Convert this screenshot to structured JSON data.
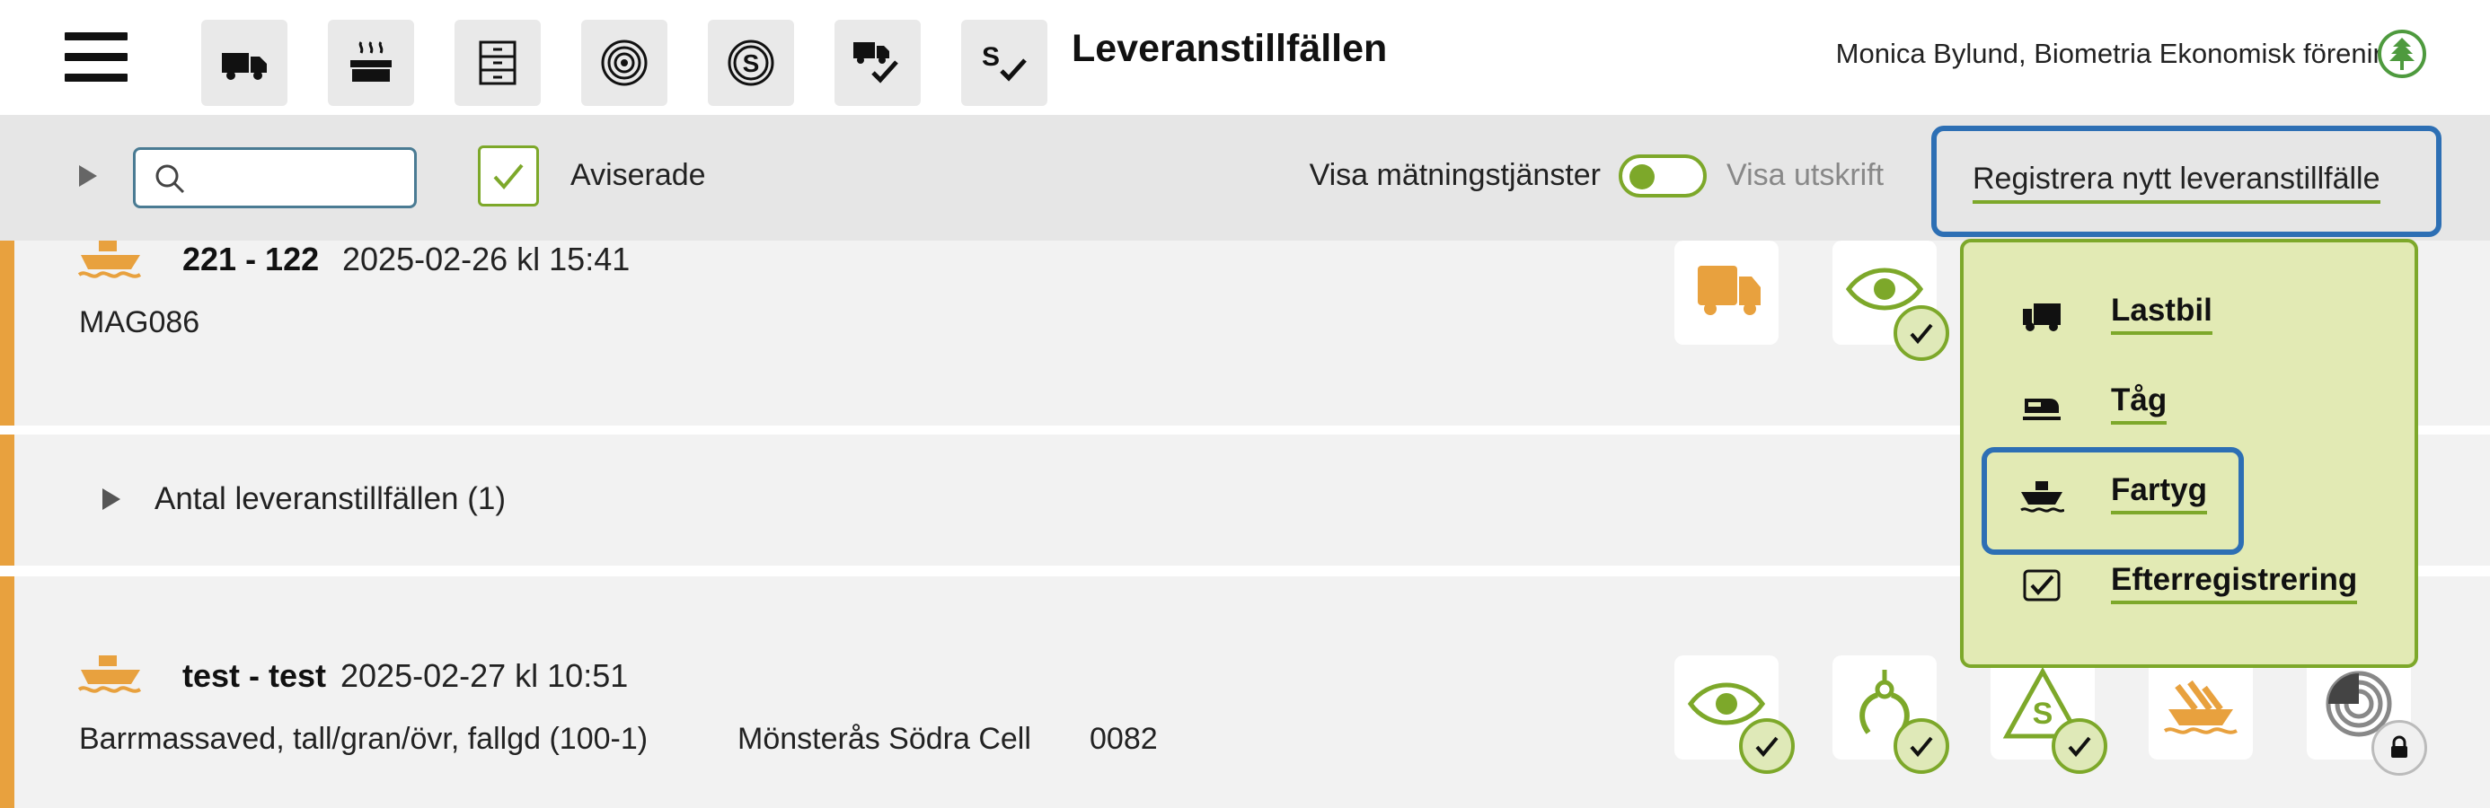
{
  "header": {
    "title": "Leveranstillfällen",
    "user": "Monica Bylund, Biometria Ekonomisk förening",
    "nav_icons": [
      "truck-icon",
      "heat-icon",
      "cabinet-icon",
      "target-icon",
      "coin-icon",
      "truck-check-icon",
      "sign-check-icon"
    ]
  },
  "toolbar": {
    "search_placeholder": "",
    "search_value": "",
    "aviserade_label": "Aviserade",
    "aviserade_checked": true,
    "visa_matningstjanster_label": "Visa mätningstjänster",
    "visa_utskrift_label": "Visa utskrift",
    "register_button_label": "Registrera nytt leveranstillfälle"
  },
  "rows": [
    {
      "code": "221 - 122",
      "date": "2025-02-26 kl 15:41",
      "subtitle": "MAG086",
      "tiles": [
        "truck-icon",
        "eye-check-icon"
      ]
    },
    {
      "group_label": "Antal leveranstillfällen (1)"
    },
    {
      "code": "test - test",
      "date": "2025-02-27 kl 10:51",
      "assortment": "Barrmassaved, tall/gran/övr, fallgd (100-1)",
      "location": "Mönsterås Södra Cell",
      "number": "0082",
      "tiles": [
        "eye-check-icon",
        "grapple-check-icon",
        "coin-warning-check-icon",
        "ship-wave-icon",
        "target-lock-icon"
      ]
    }
  ],
  "dropdown": {
    "items": [
      {
        "label": "Lastbil",
        "icon": "truck-icon"
      },
      {
        "label": "Tåg",
        "icon": "train-icon"
      },
      {
        "label": "Fartyg",
        "icon": "ship-icon",
        "focused": true
      },
      {
        "label": "Efterregistrering",
        "icon": "checkbox-icon"
      }
    ]
  },
  "colors": {
    "accent_orange": "#e8a13e",
    "accent_green": "#7da82a",
    "focus_blue": "#2d6fb4",
    "dropdown_bg": "#e2eab4"
  }
}
